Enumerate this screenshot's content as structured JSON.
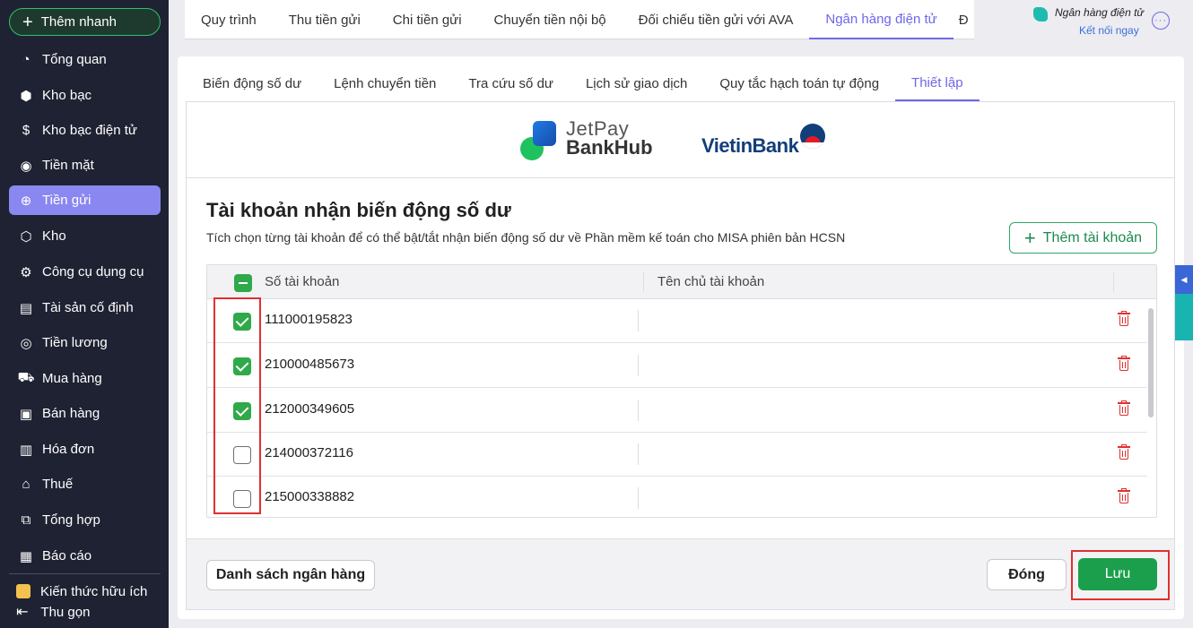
{
  "sidebar": {
    "quick_add": "Thêm nhanh",
    "items": [
      {
        "label": "Tổng quan",
        "icon": "◔"
      },
      {
        "label": "Kho bạc",
        "icon": "⬢"
      },
      {
        "label": "Kho bạc điện tử",
        "icon": "$"
      },
      {
        "label": "Tiền mặt",
        "icon": "◉"
      },
      {
        "label": "Tiền gửi",
        "icon": "⊕"
      },
      {
        "label": "Kho",
        "icon": "⬡"
      },
      {
        "label": "Công cụ dụng cụ",
        "icon": "⚙"
      },
      {
        "label": "Tài sản cố định",
        "icon": "▤"
      },
      {
        "label": "Tiền lương",
        "icon": "◎"
      },
      {
        "label": "Mua hàng",
        "icon": "⛟"
      },
      {
        "label": "Bán hàng",
        "icon": "▣"
      },
      {
        "label": "Hóa đơn",
        "icon": "▥"
      },
      {
        "label": "Thuế",
        "icon": "⌂"
      },
      {
        "label": "Tổng hợp",
        "icon": "⧉"
      },
      {
        "label": "Báo cáo",
        "icon": "▦"
      }
    ],
    "knowledge": "Kiến thức hữu ích",
    "collapse": "Thu gọn"
  },
  "top_tabs": [
    "Quy trình",
    "Thu tiền gửi",
    "Chi tiền gửi",
    "Chuyển tiền nội bộ",
    "Đối chiếu tiền gửi với AVA",
    "Ngân hàng điện tử",
    "Đ"
  ],
  "top_tab_active": "Ngân hàng điện tử",
  "ebank": {
    "name": "Ngân hàng điện tử",
    "link": "Kết nối ngay"
  },
  "sub_tabs": [
    "Biến động số dư",
    "Lệnh chuyển tiền",
    "Tra cứu số dư",
    "Lịch sử giao dịch",
    "Quy tắc hạch toán tự động",
    "Thiết lập"
  ],
  "sub_tab_active": "Thiết lập",
  "logos": {
    "jetpay_line1": "JetPay",
    "jetpay_line2": "BankHub",
    "vietinbank": "VietinBank"
  },
  "section": {
    "title": "Tài khoản nhận biến động số dư",
    "description": "Tích chọn từng tài khoản để có thể bật/tắt nhận biến động số dư về Phần mềm kế toán cho MISA phiên bản HCSN",
    "add_account": "Thêm tài khoản"
  },
  "table": {
    "columns": [
      "Số tài khoản",
      "Tên chủ tài khoản"
    ],
    "rows": [
      {
        "account": "111000195823",
        "owner": "",
        "checked": true
      },
      {
        "account": "210000485673",
        "owner": "",
        "checked": true
      },
      {
        "account": "212000349605",
        "owner": "",
        "checked": true
      },
      {
        "account": "214000372116",
        "owner": "",
        "checked": false
      },
      {
        "account": "215000338882",
        "owner": "",
        "checked": false
      }
    ]
  },
  "footer": {
    "bank_list": "Danh sách ngân hàng",
    "close": "Đóng",
    "save": "Lưu"
  },
  "colors": {
    "sidebar_bg": "#1f2233",
    "active_nav": "#8b87f0",
    "accent": "#6e68e8",
    "check_green": "#2fa94a",
    "save_green": "#1c9f4c",
    "highlight_red": "#e0302f"
  }
}
